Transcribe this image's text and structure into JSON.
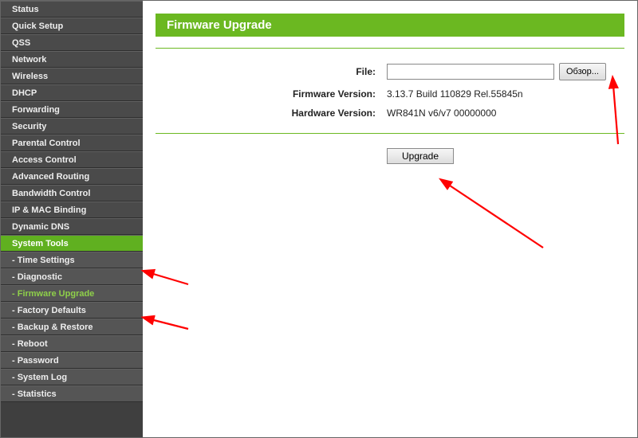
{
  "page": {
    "title": "Firmware Upgrade",
    "file_label": "File:",
    "firmware_label": "Firmware Version:",
    "firmware_value": "3.13.7 Build 110829 Rel.55845n",
    "hardware_label": "Hardware Version:",
    "hardware_value": "WR841N v6/v7 00000000",
    "browse_button": "Обзор...",
    "upgrade_button": "Upgrade",
    "file_value": ""
  },
  "sidebar": {
    "items": [
      {
        "label": "Status",
        "type": "item"
      },
      {
        "label": "Quick Setup",
        "type": "item"
      },
      {
        "label": "QSS",
        "type": "item"
      },
      {
        "label": "Network",
        "type": "item"
      },
      {
        "label": "Wireless",
        "type": "item"
      },
      {
        "label": "DHCP",
        "type": "item"
      },
      {
        "label": "Forwarding",
        "type": "item"
      },
      {
        "label": "Security",
        "type": "item"
      },
      {
        "label": "Parental Control",
        "type": "item"
      },
      {
        "label": "Access Control",
        "type": "item"
      },
      {
        "label": "Advanced Routing",
        "type": "item"
      },
      {
        "label": "Bandwidth Control",
        "type": "item"
      },
      {
        "label": "IP & MAC Binding",
        "type": "item"
      },
      {
        "label": "Dynamic DNS",
        "type": "item"
      },
      {
        "label": "System Tools",
        "type": "active-parent"
      },
      {
        "label": "- Time Settings",
        "type": "sub"
      },
      {
        "label": "- Diagnostic",
        "type": "sub"
      },
      {
        "label": "- Firmware Upgrade",
        "type": "active-sub"
      },
      {
        "label": "- Factory Defaults",
        "type": "sub"
      },
      {
        "label": "- Backup & Restore",
        "type": "sub"
      },
      {
        "label": "- Reboot",
        "type": "sub"
      },
      {
        "label": "- Password",
        "type": "sub"
      },
      {
        "label": "- System Log",
        "type": "sub"
      },
      {
        "label": "- Statistics",
        "type": "sub"
      }
    ]
  }
}
